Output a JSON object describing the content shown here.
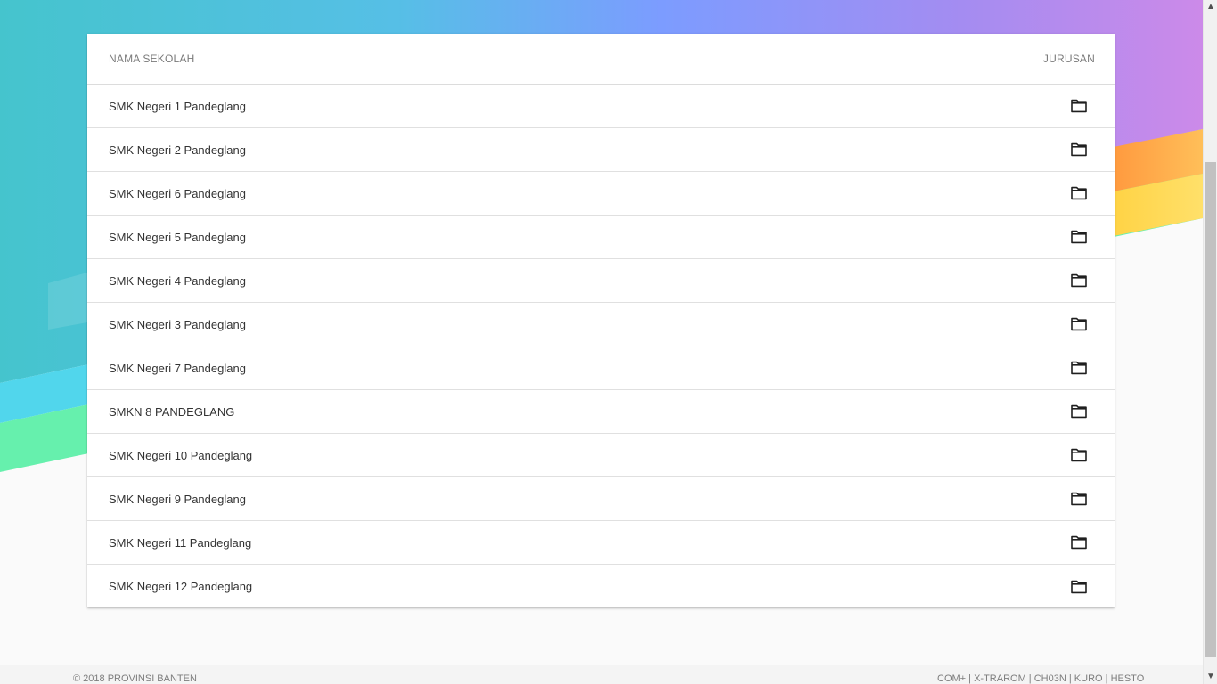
{
  "table": {
    "headers": {
      "school": "NAMA SEKOLAH",
      "major": "JURUSAN"
    },
    "rows": [
      {
        "school_name": "SMK Negeri 1 Pandeglang"
      },
      {
        "school_name": "SMK Negeri 2 Pandeglang"
      },
      {
        "school_name": "SMK Negeri 6 Pandeglang"
      },
      {
        "school_name": "SMK Negeri 5 Pandeglang"
      },
      {
        "school_name": "SMK Negeri 4 Pandeglang"
      },
      {
        "school_name": "SMK Negeri 3 Pandeglang"
      },
      {
        "school_name": "SMK Negeri 7 Pandeglang"
      },
      {
        "school_name": "SMKN 8 PANDEGLANG"
      },
      {
        "school_name": "SMK Negeri 10 Pandeglang"
      },
      {
        "school_name": "SMK Negeri 9 Pandeglang"
      },
      {
        "school_name": "SMK Negeri 11 Pandeglang"
      },
      {
        "school_name": "SMK Negeri 12 Pandeglang"
      }
    ],
    "icons": {
      "folder": "folder-icon"
    }
  },
  "footer": {
    "copyright": "© 2018 PROVINSI BANTEN",
    "credits": {
      "one": "COM+",
      "two": "X-TRAROM",
      "three": "CH03N",
      "four": "KURO",
      "five": "HESTO",
      "sep": " | "
    }
  },
  "colors": {
    "gradient_left": "#48c6cf",
    "gradient_mid": "#7aa6ff",
    "gradient_right": "#c88be9",
    "band_cyan": "#4fd8ef",
    "band_green": "#63f2a8",
    "band_orange": "#ffb14a",
    "band_yellow": "#ffd34d"
  }
}
